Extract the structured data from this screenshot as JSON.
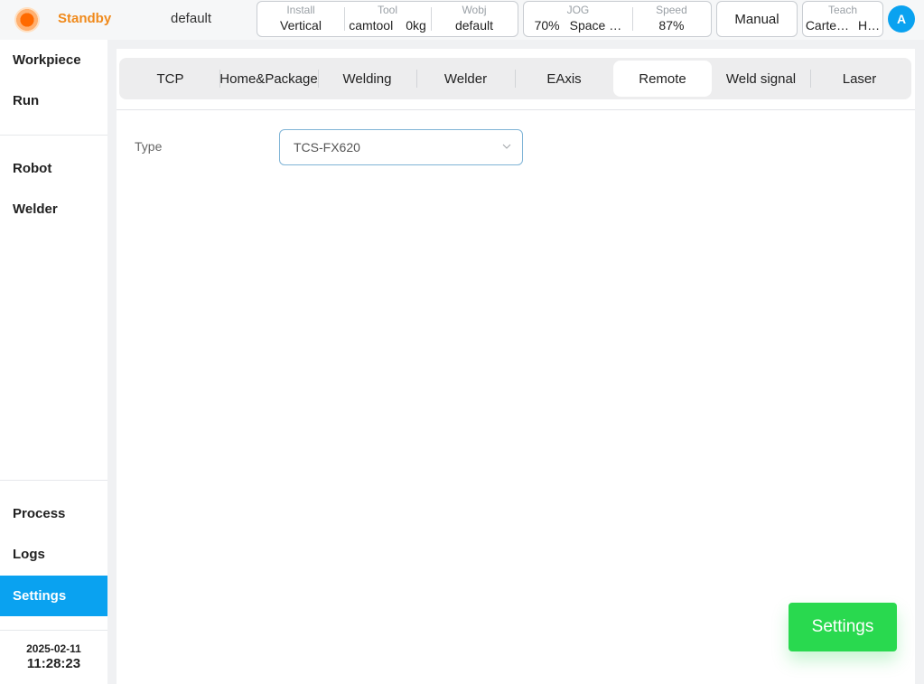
{
  "header": {
    "status": "Standby",
    "program": "default",
    "install": {
      "label": "Install",
      "value": "Vertical"
    },
    "tool": {
      "label": "Tool",
      "name": "camtool",
      "load": "0kg"
    },
    "wobj": {
      "label": "Wobj",
      "value": "default"
    },
    "jog": {
      "label": "JOG",
      "percent": "70%",
      "mode": "Space …"
    },
    "speed": {
      "label": "Speed",
      "value": "87%"
    },
    "mode_button": "Manual",
    "teach": {
      "label": "Teach",
      "frame": "Carte…",
      "option": "H…"
    },
    "user_initial": "A",
    "colors": {
      "status": "#f08a1c",
      "accent": "#0aa2f0"
    }
  },
  "sidebar": {
    "top_items": [
      "Workpiece",
      "Run"
    ],
    "mid_items": [
      "Robot",
      "Welder"
    ],
    "bottom_items": [
      "Process",
      "Logs",
      "Settings"
    ],
    "active_item": "Settings",
    "date": "2025-02-11",
    "time": "11:28:23"
  },
  "main": {
    "tabs": [
      "TCP",
      "Home&Package",
      "Welding",
      "Welder",
      "EAxis",
      "Remote",
      "Weld signal",
      "Laser"
    ],
    "active_tab": "Remote",
    "type_label": "Type",
    "type_value": "TCS-FX620",
    "fab_label": "Settings",
    "fab_color": "#29d94f"
  }
}
